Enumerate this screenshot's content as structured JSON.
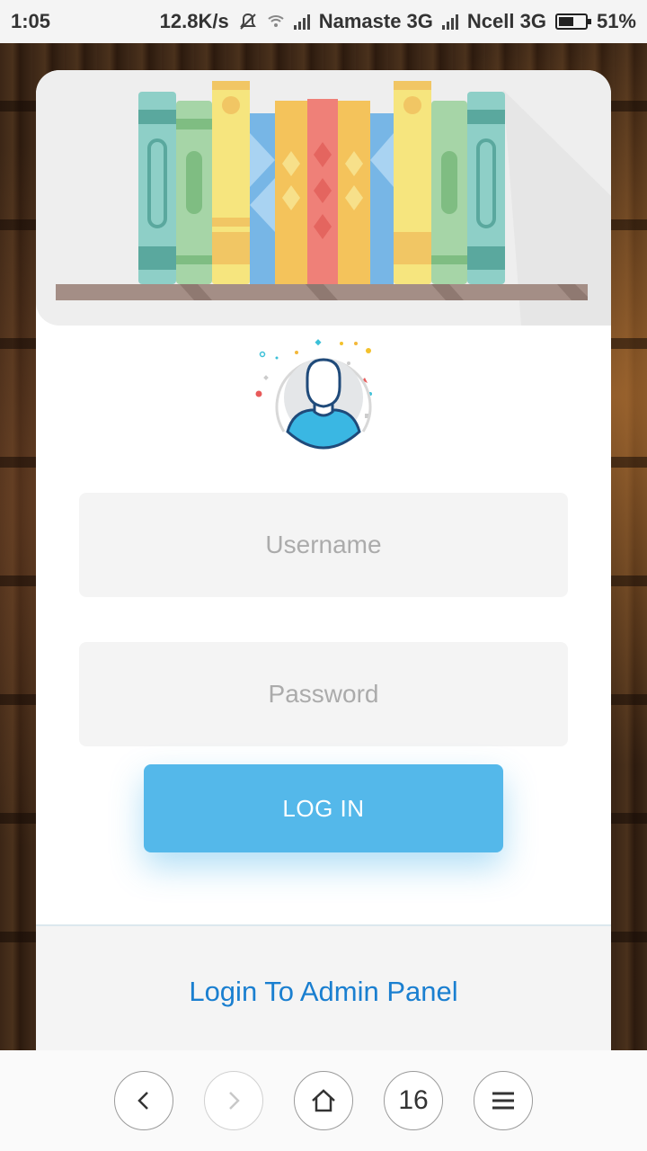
{
  "status_bar": {
    "time": "1:05",
    "speed": "12.8K/s",
    "carrier1": "Namaste 3G",
    "carrier2": "Ncell 3G",
    "battery": "51%"
  },
  "login": {
    "username_placeholder": "Username",
    "password_placeholder": "Password",
    "login_button": "LOG IN",
    "admin_link": "Login To Admin Panel"
  },
  "browser_nav": {
    "tab_count": "16"
  },
  "colors": {
    "accent": "#54b8ea",
    "link": "#1a7fd0",
    "field_bg": "#f4f4f4"
  }
}
